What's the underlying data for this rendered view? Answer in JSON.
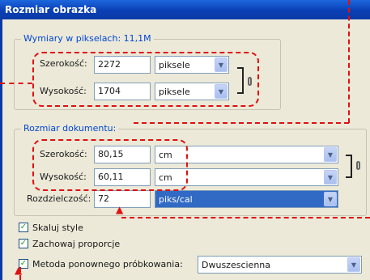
{
  "window": {
    "title": "Rozmiar obrazka"
  },
  "pixel_dimensions": {
    "legend": "Wymiary w pikselach:  11,1M",
    "width_label": "Szerokość:",
    "width_value": "2272",
    "width_unit": "piksele",
    "height_label": "Wysokość:",
    "height_value": "1704",
    "height_unit": "piksele"
  },
  "document_size": {
    "legend": "Rozmiar dokumentu:",
    "width_label": "Szerokość:",
    "width_value": "80,15",
    "width_unit": "cm",
    "height_label": "Wysokość:",
    "height_value": "60,11",
    "height_unit": "cm",
    "resolution_label": "Rozdzielczość:",
    "resolution_value": "72",
    "resolution_unit": "piks/cal"
  },
  "options": {
    "scale_styles": {
      "label": "Skaluj style",
      "checked": true
    },
    "constrain_proportions": {
      "label": "Zachowaj proporcje",
      "checked": true
    },
    "resample": {
      "label": "Metoda ponownego próbkowania:",
      "checked": true,
      "method": "Dwuszescienna"
    }
  },
  "annotation_color": "#e01010"
}
